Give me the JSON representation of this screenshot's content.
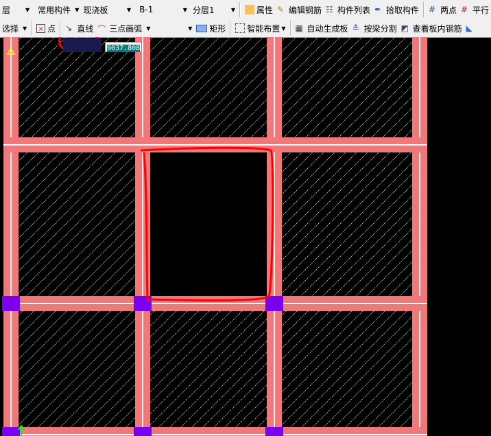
{
  "toolbar_row1": {
    "floor_label": "层",
    "component_type": "常用构件",
    "category": "现浇板",
    "component": "B-1",
    "layer": "分层1",
    "buttons": [
      "属性",
      "编辑钢筋",
      "构件列表",
      "拾取构件",
      "两点",
      "平行"
    ]
  },
  "toolbar_row2": {
    "select": "选择",
    "point": "点",
    "line": "直线",
    "arc": "三点画弧",
    "rect": "矩形",
    "smart": "智能布置",
    "auto_slab": "自动生成板",
    "split": "按梁分割",
    "view_rebar": "查看板内钢筋"
  },
  "input_tooltip": "9037.808",
  "colors": {
    "beam": "#f07878",
    "column": "#7a00ee",
    "annotation": "#ff0000",
    "hatch": "#c8c8c8"
  }
}
